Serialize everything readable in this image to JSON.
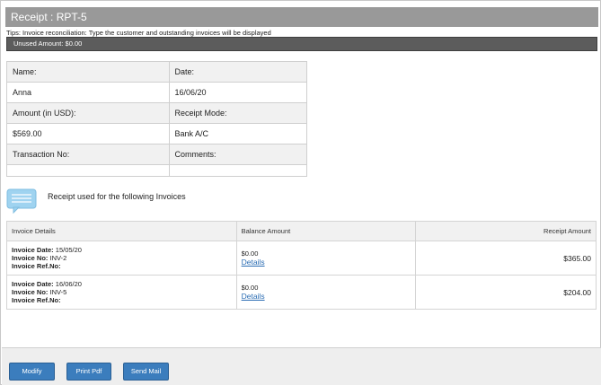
{
  "header": {
    "title": "Receipt : RPT-5"
  },
  "tips": "Tips: Invoice reconciliation: Type the customer and outstanding invoices will be displayed",
  "unused_amount": "Unused Amount: $0.00",
  "receipt_info": {
    "name_label": "Name:",
    "name_value": "Anna",
    "date_label": "Date:",
    "date_value": "16/06/20",
    "amount_label": "Amount (in USD):",
    "amount_value": "$569.00",
    "mode_label": "Receipt Mode:",
    "mode_value": "Bank A/C",
    "transaction_label": "Transaction No:",
    "transaction_value": "",
    "comments_label": "Comments:",
    "comments_value": ""
  },
  "note_icon": "speech-bubble-icon",
  "used_heading": "Receipt used for the following Invoices",
  "invoice_table": {
    "columns": [
      "Invoice Details",
      "Balance Amount",
      "Receipt Amount"
    ],
    "date_key": "Invoice Date:",
    "no_key": "Invoice No:",
    "ref_key": "Invoice Ref.No:",
    "details_link": "Details",
    "rows": [
      {
        "date": "15/05/20",
        "no": "INV-2",
        "ref": "",
        "balance": "$0.00",
        "receipt": "$365.00"
      },
      {
        "date": "16/06/20",
        "no": "INV-5",
        "ref": "",
        "balance": "$0.00",
        "receipt": "$204.00"
      }
    ]
  },
  "footer": {
    "modify_label": "Modify",
    "print_label": "Print Pdf",
    "mail_label": "Send Mail"
  },
  "colors": {
    "header_bg": "#999999",
    "unused_bg": "#5c5c5c",
    "button_bg": "#3b7dbd",
    "link": "#2a6cb3",
    "note_icon": "#9fd3f0"
  }
}
